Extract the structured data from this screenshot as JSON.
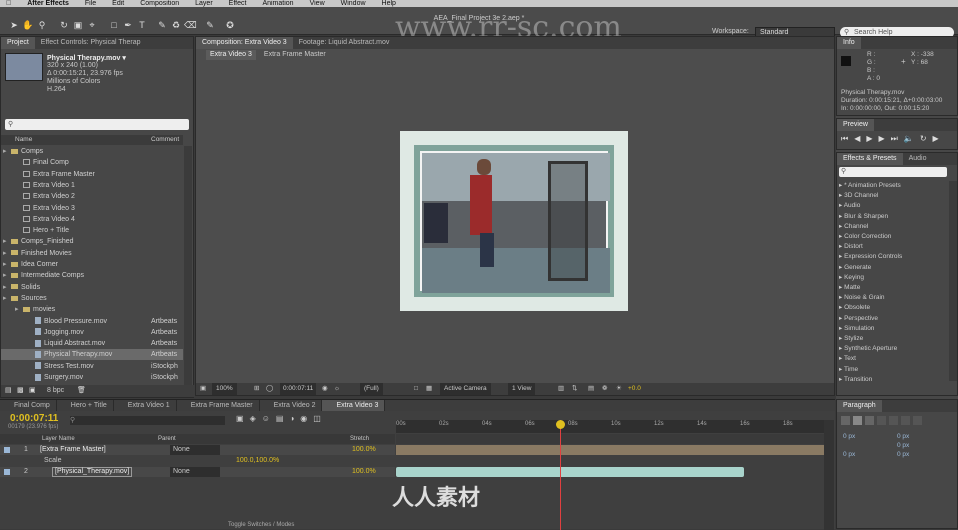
{
  "menu": {
    "app": "After Effects",
    "items": [
      "File",
      "Edit",
      "Composition",
      "Layer",
      "Effect",
      "Animation",
      "View",
      "Window",
      "Help"
    ]
  },
  "window_title": "AEA_Final Project 3e 2.aep *",
  "watermark": "www.rr-sc.com",
  "workspace": {
    "label": "Workspace:",
    "value": "Standard"
  },
  "search_help": "Search Help",
  "project_panel": {
    "tabs": [
      "Project",
      "Effect Controls: Physical Therap"
    ],
    "file_name": "Physical Therapy.mov ▾",
    "file_info": [
      "320 x 240 (1.00)",
      "Δ 0:00:15:21, 23.976 fps",
      "Millions of Colors",
      "H.264"
    ],
    "columns": [
      "Name",
      "Comment"
    ],
    "rows": [
      {
        "type": "folder",
        "indent": 0,
        "label": "Comps",
        "comment": ""
      },
      {
        "type": "comp",
        "indent": 1,
        "label": "Final Comp",
        "comment": ""
      },
      {
        "type": "comp",
        "indent": 1,
        "label": "Extra Frame Master",
        "comment": ""
      },
      {
        "type": "comp",
        "indent": 1,
        "label": "Extra Video 1",
        "comment": ""
      },
      {
        "type": "comp",
        "indent": 1,
        "label": "Extra Video 2",
        "comment": ""
      },
      {
        "type": "comp",
        "indent": 1,
        "label": "Extra Video 3",
        "comment": ""
      },
      {
        "type": "comp",
        "indent": 1,
        "label": "Extra Video 4",
        "comment": ""
      },
      {
        "type": "comp",
        "indent": 1,
        "label": "Hero + Title",
        "comment": ""
      },
      {
        "type": "folder",
        "indent": 0,
        "label": "Comps_Finished",
        "comment": ""
      },
      {
        "type": "folder",
        "indent": 0,
        "label": "Finished Movies",
        "comment": ""
      },
      {
        "type": "folder",
        "indent": 0,
        "label": "Idea Corner",
        "comment": ""
      },
      {
        "type": "folder",
        "indent": 0,
        "label": "Intermediate Comps",
        "comment": ""
      },
      {
        "type": "folder",
        "indent": 0,
        "label": "Solids",
        "comment": ""
      },
      {
        "type": "folder",
        "indent": 0,
        "label": "Sources",
        "comment": ""
      },
      {
        "type": "folder",
        "indent": 1,
        "label": "movies",
        "comment": ""
      },
      {
        "type": "movie",
        "indent": 2,
        "label": "Blood Pressure.mov",
        "comment": "Artbeats"
      },
      {
        "type": "movie",
        "indent": 2,
        "label": "Jogging.mov",
        "comment": "Artbeats"
      },
      {
        "type": "movie",
        "indent": 2,
        "label": "Liquid Abstract.mov",
        "comment": "Artbeats"
      },
      {
        "type": "movie",
        "indent": 2,
        "label": "Physical Therapy.mov",
        "comment": "Artbeats",
        "selected": true
      },
      {
        "type": "movie",
        "indent": 2,
        "label": "Stress Test.mov",
        "comment": "iStockph"
      },
      {
        "type": "movie",
        "indent": 2,
        "label": "Surgery.mov",
        "comment": "iStockph"
      }
    ],
    "bpc": "8 bpc"
  },
  "comp_panel": {
    "tab": "Composition: Extra Video 3",
    "other_tab": "Footage: Liquid Abstract.mov",
    "breadcrumbs": [
      "Extra Video 3",
      "Extra Frame Master"
    ],
    "zoom": "100%",
    "timecode": "0:00:07:11",
    "resolution": "(Full)",
    "camera": "Active Camera",
    "view": "1 View",
    "exposure": "+0.0"
  },
  "info_panel": {
    "tab": "Info",
    "r": "R :",
    "g": "G :",
    "b": "B :",
    "a": "A : 0",
    "x": "X : -338",
    "y": "Y : 68",
    "file": "Physical Therapy.mov",
    "duration": "Duration: 0:00:15:21, Δ+0:00:03:00",
    "inout": "In: 0:00:00:00, Out: 0:00:15:20"
  },
  "preview_panel": {
    "tab": "Preview"
  },
  "effects_panel": {
    "tabs": [
      "Effects & Presets",
      "Audio"
    ],
    "items": [
      "* Animation Presets",
      "3D Channel",
      "Audio",
      "Blur & Sharpen",
      "Channel",
      "Color Correction",
      "Distort",
      "Expression Controls",
      "Generate",
      "Keying",
      "Matte",
      "Noise & Grain",
      "Obsolete",
      "Perspective",
      "Simulation",
      "Stylize",
      "Synthetic Aperture",
      "Text",
      "Time",
      "Transition"
    ]
  },
  "paragraph_panel": {
    "tab": "Paragraph",
    "values": [
      "0 px",
      "0 px",
      "0 px",
      "0 px",
      "0 px"
    ]
  },
  "timeline": {
    "tabs": [
      "Final Comp",
      "Hero + Title",
      "Extra Video 1",
      "Extra Frame Master",
      "Extra Video 2",
      "Extra Video 3"
    ],
    "active_tab": "Extra Video 3",
    "timecode": "0:00:07:11",
    "fps": "00179 (23.976 fps)",
    "columns": {
      "layer": "Layer Name",
      "parent": "Parent",
      "stretch": "Stretch"
    },
    "ruler": [
      "00s",
      "02s",
      "04s",
      "06s",
      "08s",
      "10s",
      "12s",
      "14s",
      "16s",
      "18s"
    ],
    "layers": [
      {
        "num": "1",
        "name": "[Extra Frame Master]",
        "parent": "None",
        "stretch": "100.0%"
      },
      {
        "num": "2",
        "name": "[Physical_Therapy.mov]",
        "parent": "None",
        "stretch": "100.0%"
      }
    ],
    "scale_label": "Scale",
    "scale_value": "100.0,100.0%",
    "toggle_label": "Toggle Switches / Modes"
  },
  "bottom_logo": "人人素材"
}
